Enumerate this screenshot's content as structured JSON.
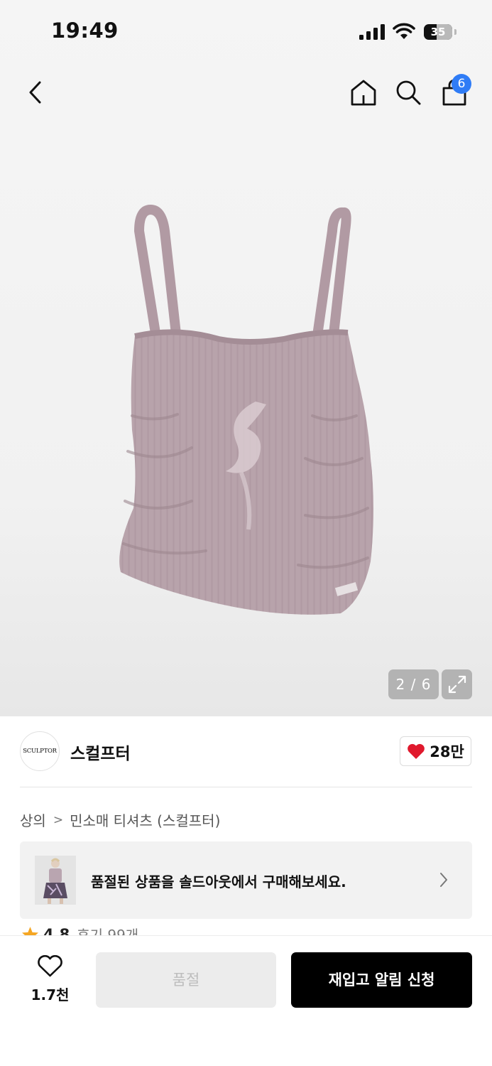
{
  "status_bar": {
    "time": "19:49",
    "battery": "35"
  },
  "nav": {
    "cart_count": "6"
  },
  "gallery": {
    "counter": "2 / 6"
  },
  "brand": {
    "logo_text": "SCULPTOR",
    "name": "스컬프터",
    "like_count": "28만"
  },
  "breadcrumb": {
    "items": [
      "상의",
      "민소매 티셔츠 (스컬프터)"
    ]
  },
  "soldout_banner": {
    "text": "품절된 상품을 솔드아웃에서 구매해보세요."
  },
  "rating": {
    "score": "4.8",
    "reviews": "후기 99개"
  },
  "bottom_bar": {
    "wish_count": "1.7천",
    "soldout_label": "품절",
    "restock_label": "재입고 알림 신청"
  },
  "colors": {
    "accent_blue": "#2f7cf6",
    "heart_red": "#e0192d",
    "star_orange": "#f5a623",
    "product_mauve": "#b5a0a8"
  }
}
